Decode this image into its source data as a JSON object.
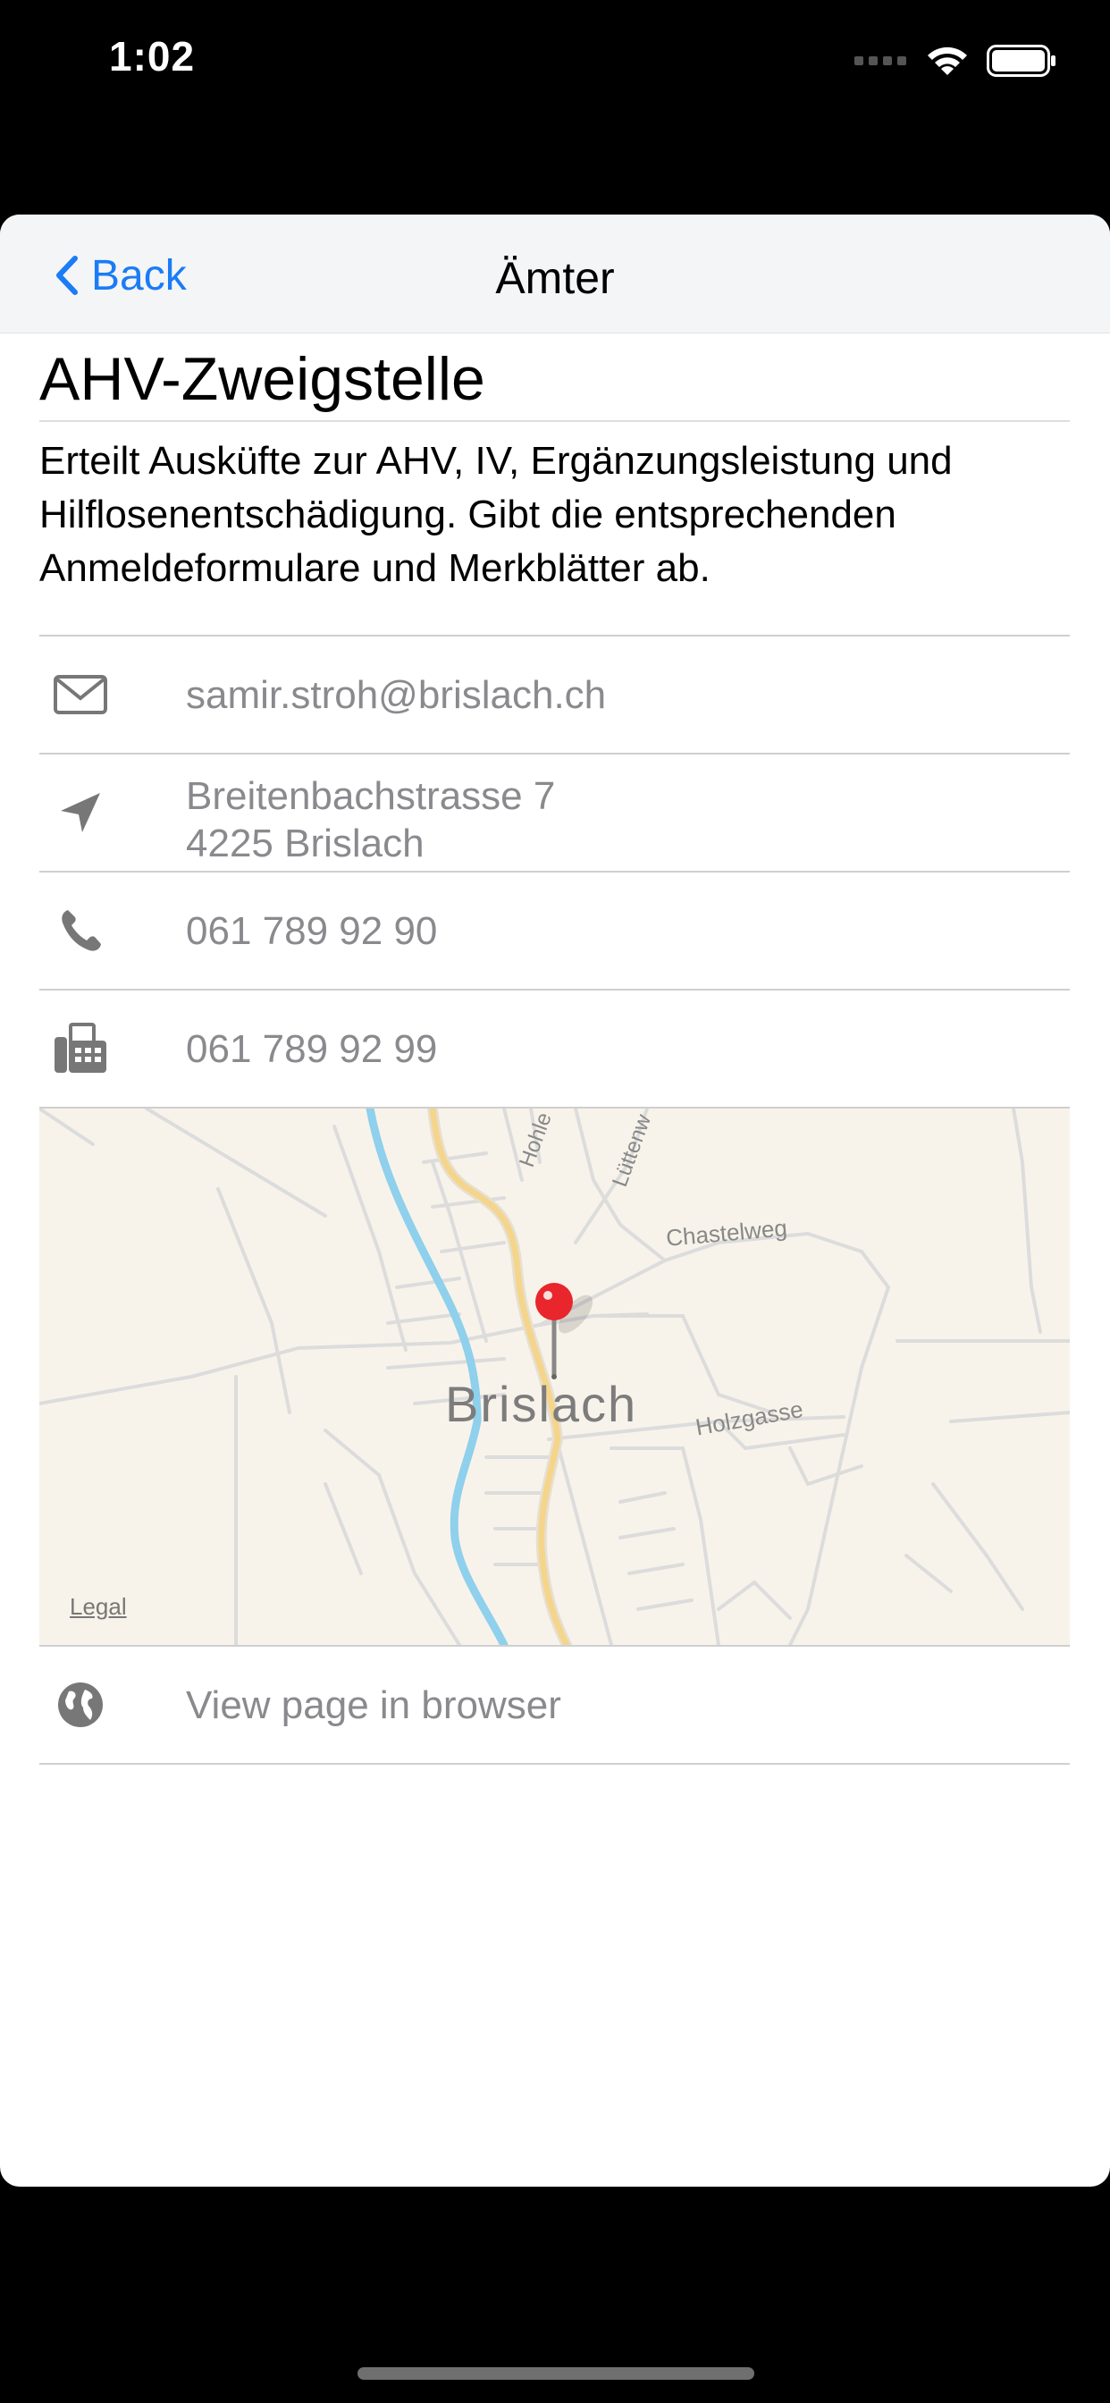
{
  "status": {
    "time": "1:02"
  },
  "nav": {
    "back_label": "Back",
    "title": "Ämter"
  },
  "office": {
    "name": "AHV-Zweigstelle",
    "description": "Erteilt Ausküfte zur AHV, IV, Ergänzungsleistung und Hilflosenentschädigung. Gibt die entsprechenden Anmeldeformulare und Merkblätter ab.",
    "email": "samir.stroh@brislach.ch",
    "address_line1": "Breitenbachstrasse 7",
    "address_line2": "4225 Brislach",
    "phone": "061 789 92 90",
    "fax": "061 789 92 99",
    "web_label": "View page in browser"
  },
  "map": {
    "place_label": "Brislach",
    "street_labels": [
      "Hohle Gass",
      "Lüttenw",
      "Chastelweg",
      "Holzgasse"
    ],
    "legal_label": "Legal"
  },
  "colors": {
    "accent": "#1a7cf6",
    "pin": "#e8262c",
    "river": "#8fd0ec",
    "main_road": "#f5d58c"
  }
}
